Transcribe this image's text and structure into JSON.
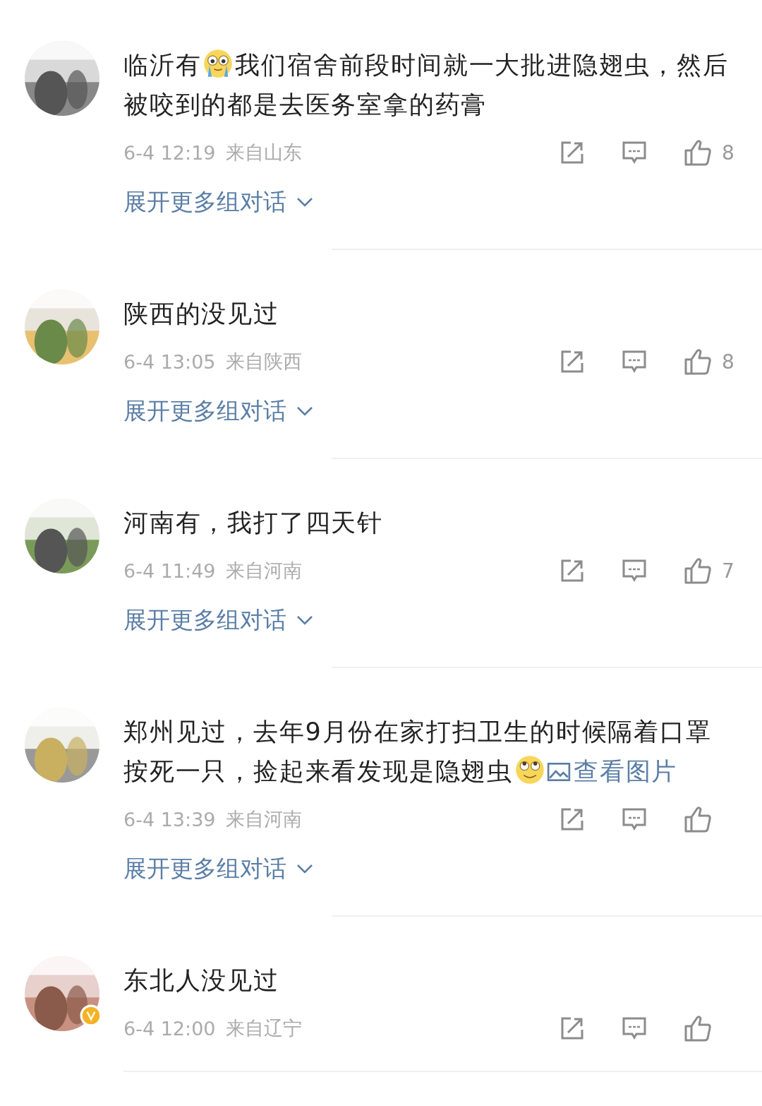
{
  "comments": [
    {
      "verified": false,
      "parts": [
        {
          "kind": "text",
          "text": "临沂有"
        },
        {
          "kind": "cry"
        },
        {
          "kind": "text",
          "text": "我们宿舍前段时间就一大批进隐翅虫，然后被咬到的都是去医务室拿的药膏"
        }
      ],
      "time": "6-4 12:19",
      "location": "来自山东",
      "likes": "8",
      "expand": "展开更多组对话"
    },
    {
      "verified": false,
      "parts": [
        {
          "kind": "text",
          "text": "陕西的没见过"
        }
      ],
      "time": "6-4 13:05",
      "location": "来自陕西",
      "likes": "8",
      "expand": "展开更多组对话"
    },
    {
      "verified": false,
      "parts": [
        {
          "kind": "text",
          "text": "河南有，我打了四天针"
        }
      ],
      "time": "6-4 11:49",
      "location": "来自河南",
      "likes": "7",
      "expand": "展开更多组对话"
    },
    {
      "verified": false,
      "parts": [
        {
          "kind": "text",
          "text": "郑州见过，去年9月份在家打扫卫生的时候隔着口罩按死一只，捡起来看发现是隐翅虫"
        },
        {
          "kind": "roll"
        },
        {
          "kind": "link",
          "text": "查看图片"
        }
      ],
      "time": "6-4 13:39",
      "location": "来自河南",
      "expand": "展开更多组对话"
    },
    {
      "verified": true,
      "parts": [
        {
          "kind": "text",
          "text": "东北人没见过"
        }
      ],
      "time": "6-4 12:00",
      "location": "来自辽宁"
    }
  ]
}
